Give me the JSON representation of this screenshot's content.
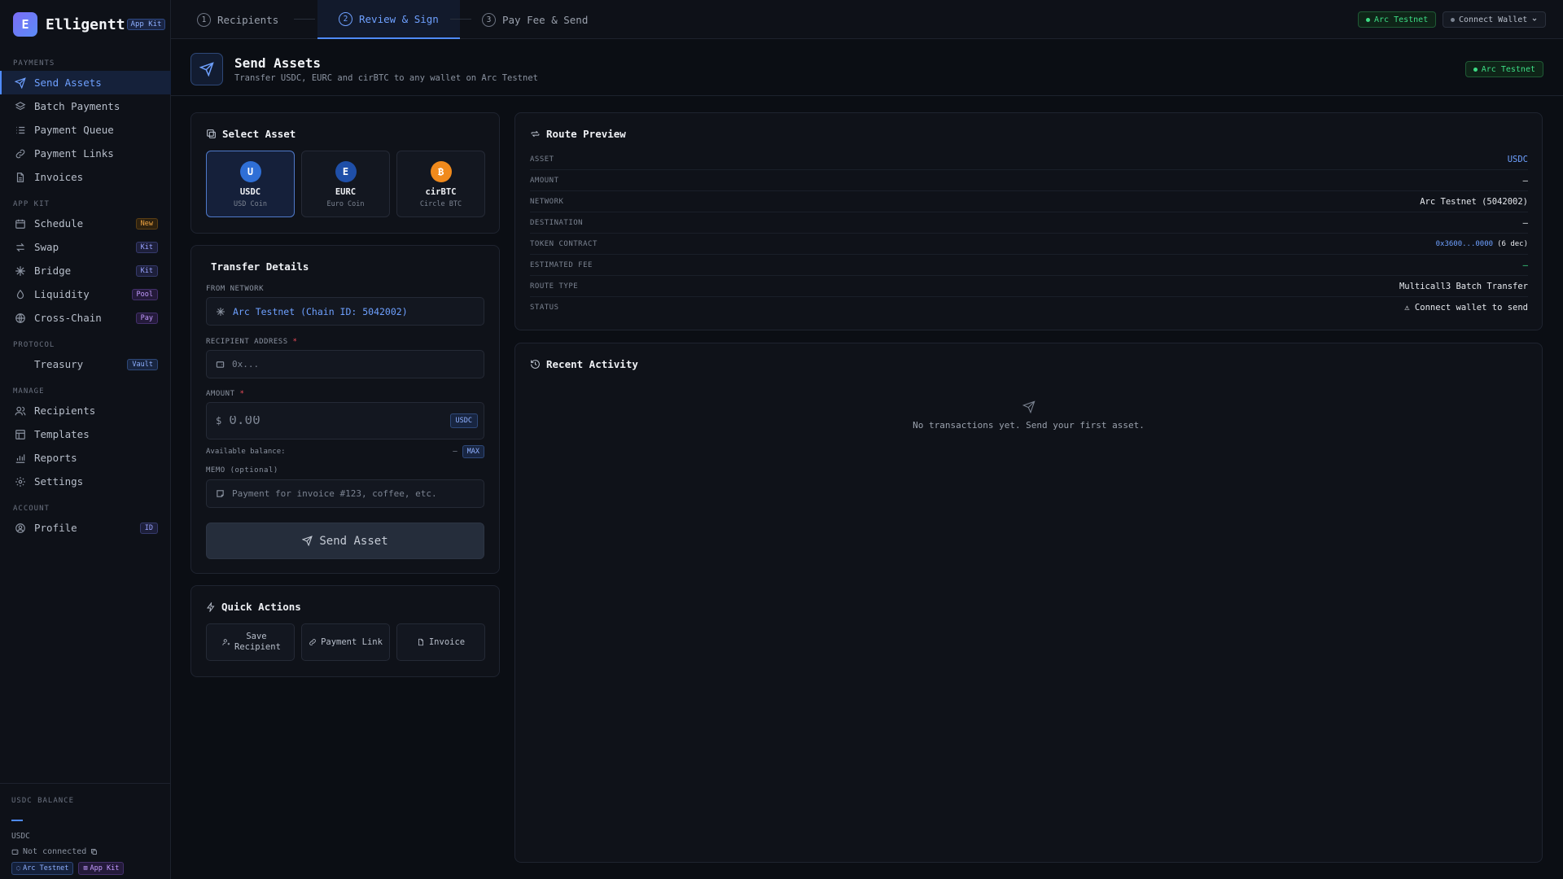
{
  "brand": {
    "logo_letter": "E",
    "name": "Elligentt",
    "badge": "App Kit"
  },
  "sidebar": {
    "sections": [
      {
        "label": "PAYMENTS",
        "items": [
          {
            "label": "Send Assets",
            "icon": "send-icon",
            "active": true
          },
          {
            "label": "Batch Payments",
            "icon": "layers-icon"
          },
          {
            "label": "Payment Queue",
            "icon": "list-icon"
          },
          {
            "label": "Payment Links",
            "icon": "link-icon"
          },
          {
            "label": "Invoices",
            "icon": "document-icon"
          }
        ]
      },
      {
        "label": "APP KIT",
        "items": [
          {
            "label": "Schedule",
            "icon": "calendar-icon",
            "badge": "New"
          },
          {
            "label": "Swap",
            "icon": "swap-icon",
            "badge": "Kit"
          },
          {
            "label": "Bridge",
            "icon": "bridge-icon",
            "badge": "Kit"
          },
          {
            "label": "Liquidity",
            "icon": "droplet-icon",
            "badge": "Pool"
          },
          {
            "label": "Cross-Chain",
            "icon": "globe-icon",
            "badge": "Pay"
          }
        ]
      },
      {
        "label": "PROTOCOL",
        "items": [
          {
            "label": "Treasury",
            "icon": "vault-icon",
            "badge": "Vault"
          }
        ]
      },
      {
        "label": "MANAGE",
        "items": [
          {
            "label": "Recipients",
            "icon": "users-icon"
          },
          {
            "label": "Templates",
            "icon": "template-icon"
          },
          {
            "label": "Reports",
            "icon": "bar-chart-icon"
          },
          {
            "label": "Settings",
            "icon": "gear-icon"
          }
        ]
      },
      {
        "label": "ACCOUNT",
        "items": [
          {
            "label": "Profile",
            "icon": "user-circle-icon",
            "badge": "ID"
          }
        ]
      }
    ],
    "footer": {
      "label": "USDC BALANCE",
      "unit": "USDC",
      "status": "Not connected",
      "chip_network": "Arc Testnet",
      "chip_kit": "App Kit"
    }
  },
  "topbar": {
    "steps": [
      {
        "num": "1",
        "label": "Recipients"
      },
      {
        "num": "2",
        "label": "Review & Sign",
        "active": true
      },
      {
        "num": "3",
        "label": "Pay Fee & Send"
      }
    ],
    "network": "Arc Testnet",
    "wallet": "Connect Wallet"
  },
  "header": {
    "title": "Send Assets",
    "subtitle": "Transfer USDC, EURC and cirBTC to any wallet on Arc Testnet",
    "network": "Arc Testnet"
  },
  "select_asset": {
    "title": "Select Asset",
    "assets": [
      {
        "letter": "U",
        "symbol": "USDC",
        "name": "USD Coin",
        "color": "#2f6fd6",
        "selected": true
      },
      {
        "letter": "E",
        "symbol": "EURC",
        "name": "Euro Coin",
        "color": "#1f4fa8"
      },
      {
        "letter": "₿",
        "symbol": "cirBTC",
        "name": "Circle BTC",
        "color": "#f08a1c"
      }
    ]
  },
  "transfer": {
    "title": "Transfer Details",
    "from_label": "FROM NETWORK",
    "from_value": "Arc Testnet (Chain ID: 5042002)",
    "recipient_label": "RECIPIENT ADDRESS",
    "required_mark": "*",
    "recipient_placeholder": "0x...",
    "amount_label": "AMOUNT",
    "currency_symbol": "$",
    "amount_placeholder": "0.00",
    "amount_unit": "USDC",
    "balance_label": "Available balance:",
    "balance_value": "—",
    "max_label": "MAX",
    "memo_label": "MEMO (optional)",
    "memo_placeholder": "Payment for invoice #123, coffee, etc.",
    "send_label": "Send Asset"
  },
  "quick_actions": {
    "title": "Quick Actions",
    "buttons": [
      {
        "label": "Save Recipient",
        "icon": "user-plus-icon"
      },
      {
        "label": "Payment Link",
        "icon": "link-icon"
      },
      {
        "label": "Invoice",
        "icon": "document-icon"
      }
    ]
  },
  "route_preview": {
    "title": "Route Preview",
    "rows": [
      {
        "key": "ASSET",
        "value": "USDC",
        "style": "blue"
      },
      {
        "key": "AMOUNT",
        "value": "—"
      },
      {
        "key": "NETWORK",
        "value": "Arc Testnet (5042002)"
      },
      {
        "key": "DESTINATION",
        "value": "—"
      },
      {
        "key": "TOKEN CONTRACT",
        "value": "0x3600...0000",
        "suffix": "(6 dec)",
        "style": "blue"
      },
      {
        "key": "ESTIMATED FEE",
        "value": "—",
        "style": "green"
      },
      {
        "key": "ROUTE TYPE",
        "value": "Multicall3 Batch Transfer"
      },
      {
        "key": "STATUS",
        "value": "⚠ Connect wallet to send"
      }
    ]
  },
  "recent_activity": {
    "title": "Recent Activity",
    "empty_text": "No transactions yet. Send your first asset."
  }
}
